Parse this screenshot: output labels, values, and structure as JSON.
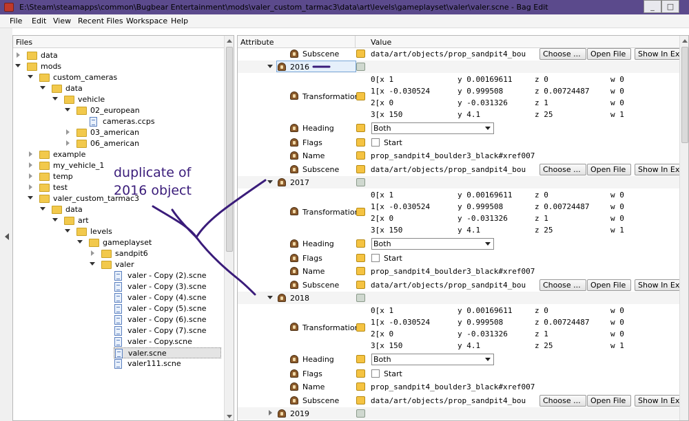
{
  "window": {
    "title": "E:\\Steam\\steamapps\\common\\Bugbear Entertainment\\mods\\valer_custom_tarmac3\\data\\art\\levels\\gameplayset\\valer\\valer.scne - Bag Edit",
    "minimize_label": "_",
    "maximize_label": "□"
  },
  "menu": [
    "File",
    "Edit",
    "View",
    "Recent Files",
    "Workspace",
    "Help"
  ],
  "files_panel": {
    "header": "Files",
    "tree": [
      {
        "label": "data",
        "type": "folder",
        "depth": 0,
        "state": "closed"
      },
      {
        "label": "mods",
        "type": "folder",
        "depth": 0,
        "state": "open"
      },
      {
        "label": "custom_cameras",
        "type": "folder",
        "depth": 1,
        "state": "open"
      },
      {
        "label": "data",
        "type": "folder",
        "depth": 2,
        "state": "open"
      },
      {
        "label": "vehicle",
        "type": "folder",
        "depth": 3,
        "state": "open"
      },
      {
        "label": "02_european",
        "type": "folder",
        "depth": 4,
        "state": "open"
      },
      {
        "label": "cameras.ccps",
        "type": "file",
        "depth": 5,
        "state": "none"
      },
      {
        "label": "03_american",
        "type": "folder",
        "depth": 4,
        "state": "closed"
      },
      {
        "label": "06_american",
        "type": "folder",
        "depth": 4,
        "state": "closed"
      },
      {
        "label": "example",
        "type": "folder",
        "depth": 1,
        "state": "closed"
      },
      {
        "label": "my_vehicle_1",
        "type": "folder",
        "depth": 1,
        "state": "closed"
      },
      {
        "label": "temp",
        "type": "folder",
        "depth": 1,
        "state": "closed"
      },
      {
        "label": "test",
        "type": "folder",
        "depth": 1,
        "state": "closed"
      },
      {
        "label": "valer_custom_tarmac3",
        "type": "folder",
        "depth": 1,
        "state": "open"
      },
      {
        "label": "data",
        "type": "folder",
        "depth": 2,
        "state": "open"
      },
      {
        "label": "art",
        "type": "folder",
        "depth": 3,
        "state": "open"
      },
      {
        "label": "levels",
        "type": "folder",
        "depth": 4,
        "state": "open"
      },
      {
        "label": "gameplayset",
        "type": "folder",
        "depth": 5,
        "state": "open"
      },
      {
        "label": "sandpit6",
        "type": "folder",
        "depth": 6,
        "state": "closed"
      },
      {
        "label": "valer",
        "type": "folder",
        "depth": 6,
        "state": "open"
      },
      {
        "label": "valer - Copy (2).scne",
        "type": "file",
        "depth": 7,
        "state": "none"
      },
      {
        "label": "valer - Copy (3).scne",
        "type": "file",
        "depth": 7,
        "state": "none"
      },
      {
        "label": "valer - Copy (4).scne",
        "type": "file",
        "depth": 7,
        "state": "none"
      },
      {
        "label": "valer - Copy (5).scne",
        "type": "file",
        "depth": 7,
        "state": "none"
      },
      {
        "label": "valer - Copy (6).scne",
        "type": "file",
        "depth": 7,
        "state": "none"
      },
      {
        "label": "valer - Copy (7).scne",
        "type": "file",
        "depth": 7,
        "state": "none"
      },
      {
        "label": "valer - Copy.scne",
        "type": "file",
        "depth": 7,
        "state": "none"
      },
      {
        "label": "valer.scne",
        "type": "file",
        "depth": 7,
        "state": "selected"
      },
      {
        "label": "valer111.scne",
        "type": "file",
        "depth": 7,
        "state": "none"
      }
    ]
  },
  "attr_panel": {
    "col_attribute": "Attribute",
    "col_value": "Value",
    "buttons": {
      "choose": "Choose ...",
      "open": "Open File",
      "show": "Show In Explorer"
    },
    "subscene_value": "data/art/objects/prop_sandpit4_bou",
    "name_value": "prop_sandpit4_boulder3_black#xref007",
    "heading_value": "Both",
    "flags_label": "Start",
    "labels": {
      "subscene": "Subscene",
      "transformation": "Transformation",
      "heading": "Heading",
      "flags": "Flags",
      "name": "Name"
    },
    "matrix": [
      [
        "0[x 1",
        "y 0.00169611",
        "z 0",
        "w 0"
      ],
      [
        "1[x -0.030524",
        "y 0.999508",
        "z 0.00724487",
        "w 0"
      ],
      [
        "2[x 0",
        "y -0.031326",
        "z 1",
        "w 0"
      ],
      [
        "3[x 150",
        "y 4.1",
        "z 25",
        "w 1"
      ]
    ],
    "groups": [
      "2016",
      "2017",
      "2018",
      "2019"
    ]
  },
  "annotation": {
    "line1": "duplicate of",
    "line2": "2016 object"
  },
  "colors": {
    "titlebar": "#5b4a8c",
    "annotation_ink": "#3a1c7a",
    "selection": "#e6f0fb"
  }
}
